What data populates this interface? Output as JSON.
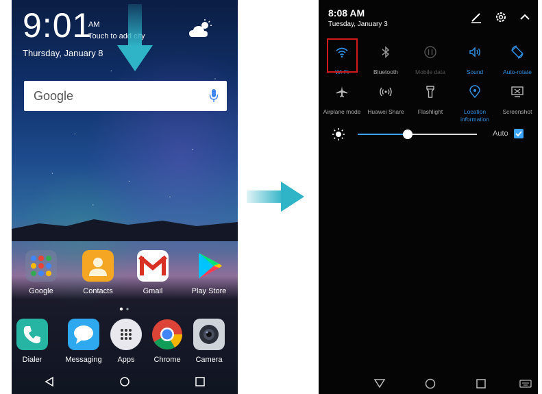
{
  "lock_screen": {
    "time": "9:01",
    "am_pm": "AM",
    "city_hint": "Touch to add city",
    "date": "Thursday, January 8",
    "weather_icon": "partly-cloudy-icon",
    "search_logo": "Google",
    "apps_row1": [
      {
        "label": "Google",
        "icon": "google-folder-icon"
      },
      {
        "label": "Contacts",
        "icon": "contacts-icon"
      },
      {
        "label": "Gmail",
        "icon": "gmail-icon"
      },
      {
        "label": "Play Store",
        "icon": "play-store-icon"
      }
    ],
    "dock": [
      {
        "label": "Dialer",
        "icon": "dialer-icon"
      },
      {
        "label": "Messaging",
        "icon": "messaging-icon"
      },
      {
        "label": "Apps",
        "icon": "apps-icon"
      },
      {
        "label": "Chrome",
        "icon": "chrome-icon"
      },
      {
        "label": "Camera",
        "icon": "camera-icon"
      }
    ],
    "page_indicator": {
      "pages": 2,
      "current": 1
    }
  },
  "quick_settings": {
    "time": "8:08 AM",
    "date": "Tuesday, January 3",
    "tiles_row1": [
      {
        "label": "Wi-Fi",
        "state": "on",
        "icon": "wifi-icon"
      },
      {
        "label": "Bluetooth",
        "state": "off",
        "icon": "bluetooth-icon"
      },
      {
        "label": "Mobile data",
        "state": "disabled",
        "icon": "mobile-data-icon"
      },
      {
        "label": "Sound",
        "state": "on",
        "icon": "sound-icon"
      },
      {
        "label": "Auto-rotate",
        "state": "on",
        "icon": "auto-rotate-icon"
      }
    ],
    "tiles_row2": [
      {
        "label": "Airplane mode",
        "state": "off",
        "icon": "airplane-icon"
      },
      {
        "label": "Huawei Share",
        "state": "off",
        "icon": "huawei-share-icon"
      },
      {
        "label": "Flashlight",
        "state": "off",
        "icon": "flashlight-icon"
      },
      {
        "label": "Location information",
        "state": "on",
        "icon": "location-icon"
      },
      {
        "label": "Screenshot",
        "state": "off",
        "icon": "screenshot-icon"
      }
    ],
    "brightness_level": 0.42,
    "auto_label": "Auto",
    "auto_checked": true
  },
  "colors": {
    "accent_blue": "#2f8fe0",
    "highlight_red": "#d21a1a",
    "arrow_teal": "#2fb3c6"
  }
}
